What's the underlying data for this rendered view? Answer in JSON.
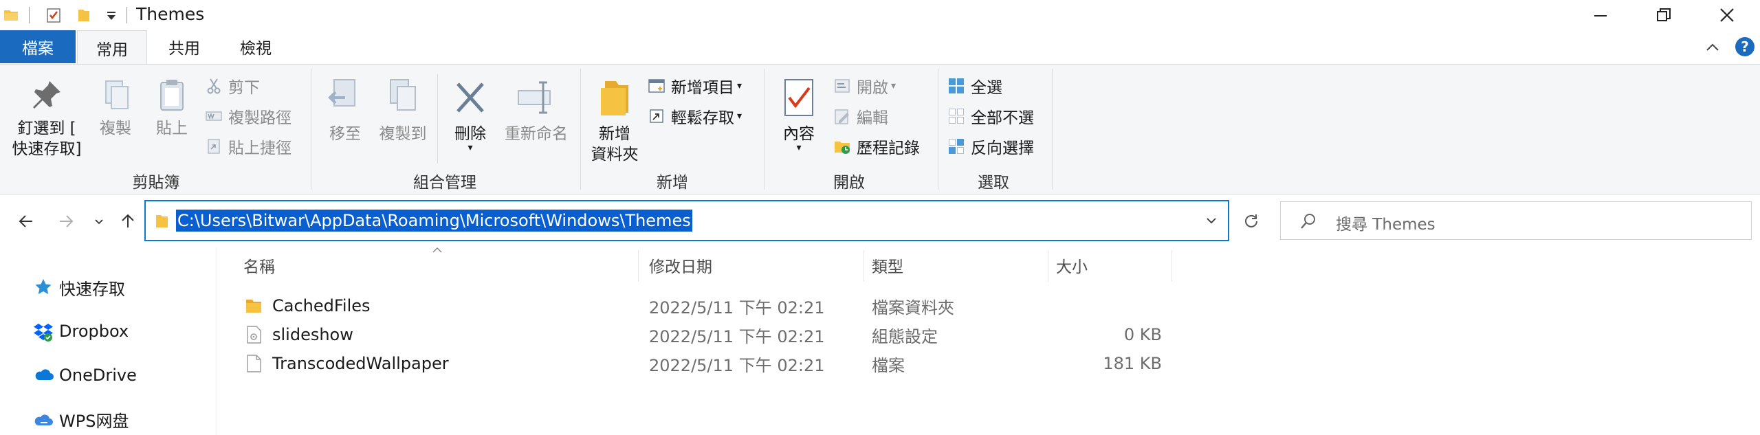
{
  "window": {
    "title": "Themes"
  },
  "ribbon_tabs": {
    "file": "檔案",
    "home": "常用",
    "share": "共用",
    "view": "檢視"
  },
  "ribbon": {
    "clipboard": {
      "label": "剪貼簿",
      "pin_quick_access_line1": "釘選到 [",
      "pin_quick_access_line2": "快速存取]",
      "copy": "複製",
      "paste": "貼上",
      "cut": "剪下",
      "copy_path": "複製路徑",
      "paste_shortcut": "貼上捷徑"
    },
    "organize": {
      "label": "組合管理",
      "move_to": "移至",
      "copy_to": "複製到",
      "delete": "刪除",
      "rename": "重新命名"
    },
    "new": {
      "label": "新增",
      "new_folder_line1": "新增",
      "new_folder_line2": "資料夾",
      "new_item": "新增項目",
      "easy_access": "輕鬆存取"
    },
    "open": {
      "label": "開啟",
      "properties": "內容",
      "open": "開啟",
      "edit": "編輯",
      "history": "歷程記錄"
    },
    "select": {
      "label": "選取",
      "select_all": "全選",
      "select_none": "全部不選",
      "invert_selection": "反向選擇"
    }
  },
  "address_bar": {
    "path": "C:\\Users\\Bitwar\\AppData\\Roaming\\Microsoft\\Windows\\Themes"
  },
  "search": {
    "placeholder": "搜尋 Themes"
  },
  "nav_pane": {
    "items": [
      {
        "label": "快速存取"
      },
      {
        "label": "Dropbox"
      },
      {
        "label": "OneDrive"
      },
      {
        "label": "WPS网盘"
      }
    ]
  },
  "file_list": {
    "columns": {
      "name": "名稱",
      "modified": "修改日期",
      "type": "類型",
      "size": "大小"
    },
    "rows": [
      {
        "name": "CachedFiles",
        "modified": "2022/5/11 下午 02:21",
        "type": "檔案資料夾",
        "size": ""
      },
      {
        "name": "slideshow",
        "modified": "2022/5/11 下午 02:21",
        "type": "組態設定",
        "size": "0 KB"
      },
      {
        "name": "TranscodedWallpaper",
        "modified": "2022/5/11 下午 02:21",
        "type": "檔案",
        "size": "181 KB"
      }
    ]
  },
  "colors": {
    "accent": "#0a78d7",
    "file_tab": "#1a6ac0",
    "folder": "#f5c242",
    "selection": "#0a5fd0"
  }
}
